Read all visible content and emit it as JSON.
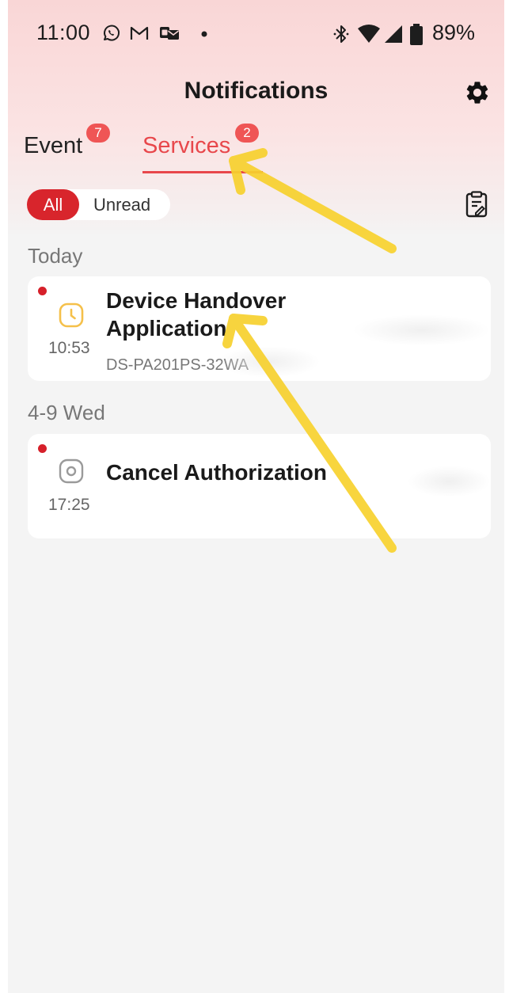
{
  "status_bar": {
    "time": "11:00",
    "left_icons": [
      "whatsapp-icon",
      "gmail-icon",
      "mail-card-icon",
      "dot-icon"
    ],
    "right_icons": [
      "bluetooth-icon",
      "wifi-icon",
      "signal-icon",
      "battery-icon"
    ],
    "battery": "89%"
  },
  "header": {
    "title": "Notifications",
    "settings_icon": "gear-icon"
  },
  "tabs": [
    {
      "label": "Event",
      "badge": "7",
      "active": false
    },
    {
      "label": "Services",
      "badge": "2",
      "active": true
    }
  ],
  "filter": {
    "all_label": "All",
    "unread_label": "Unread",
    "selected": "All"
  },
  "sections": [
    {
      "header": "Today",
      "items": [
        {
          "title": "Device Handover Application",
          "time": "10:53",
          "subtitle": "DS-PA201PS-32WA",
          "unread": true,
          "icon": "clock-icon"
        }
      ]
    },
    {
      "header": "4-9 Wed",
      "items": [
        {
          "title": "Cancel Authorization",
          "time": "17:25",
          "subtitle": "",
          "unread": true,
          "icon": "camera-icon"
        }
      ]
    }
  ],
  "colors": {
    "accent": "#e8474b",
    "filter_active": "#d6252c",
    "badge": "#ef5555",
    "unread_dot": "#d6202a",
    "annotation_arrow": "#f7d12e"
  }
}
